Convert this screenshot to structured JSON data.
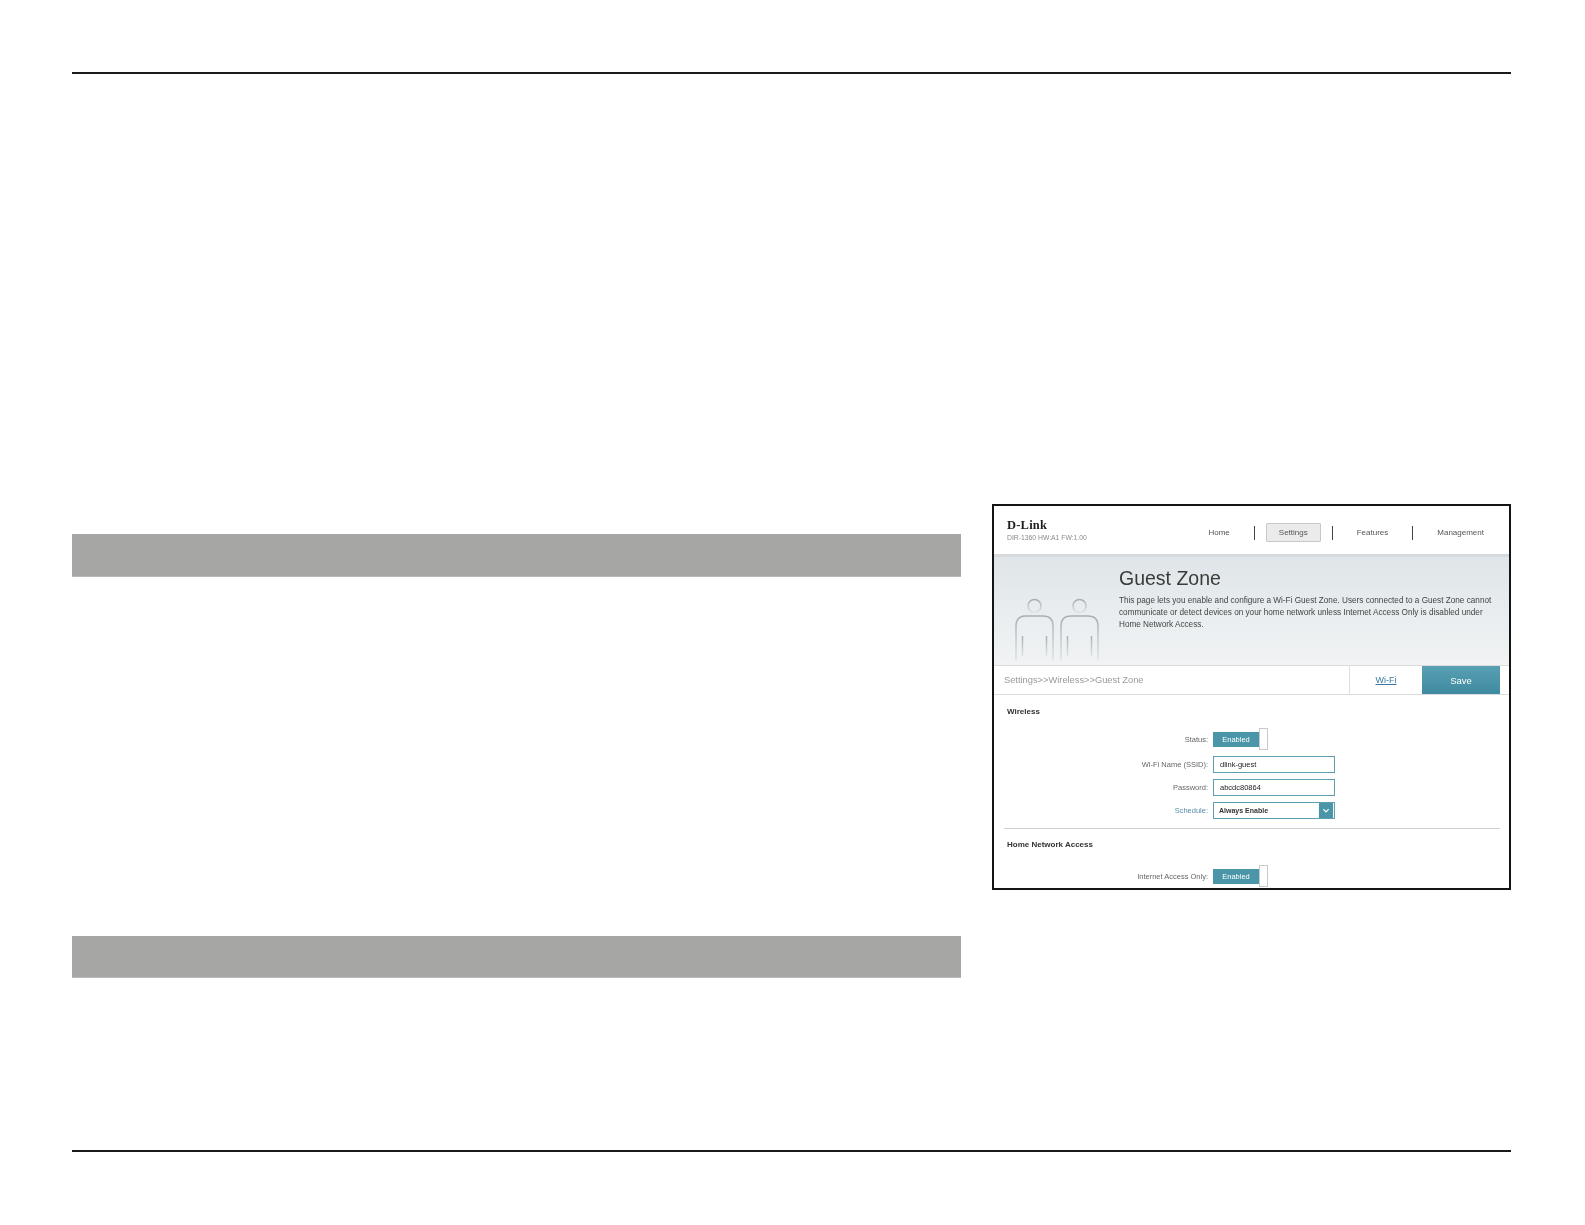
{
  "router_screenshot": {
    "logo": "D-Link",
    "model": "DIR-1360 HW:A1 FW:1.00",
    "nav": [
      {
        "label": "Home",
        "selected": false
      },
      {
        "label": "Settings",
        "selected": true
      },
      {
        "label": "Features",
        "selected": false
      },
      {
        "label": "Management",
        "selected": false
      }
    ],
    "title": "Guest Zone",
    "description": "This page lets you enable and configure a Wi-Fi Guest Zone. Users connected to a Guest Zone cannot communicate or detect devices on your home network unless Internet Access Only is disabled under Home Network Access.",
    "breadcrumb": "Settings>>Wireless>>Guest Zone",
    "wifi_link": "Wi-Fi",
    "save_button": "Save",
    "sections": [
      {
        "title": "Wireless",
        "fields": [
          {
            "kind": "toggle",
            "label": "Status:",
            "value": "Enabled",
            "on": true
          },
          {
            "kind": "text",
            "label": "Wi-Fi Name (SSID):",
            "value": "dlink-guest"
          },
          {
            "kind": "text",
            "label": "Password:",
            "value": "abcdc80864"
          },
          {
            "kind": "select",
            "label": "Schedule:",
            "value": "Always Enable"
          }
        ]
      },
      {
        "title": "Home Network Access",
        "fields": [
          {
            "kind": "toggle",
            "label": "Internet Access Only:",
            "value": "Enabled",
            "on": true
          }
        ]
      }
    ]
  }
}
